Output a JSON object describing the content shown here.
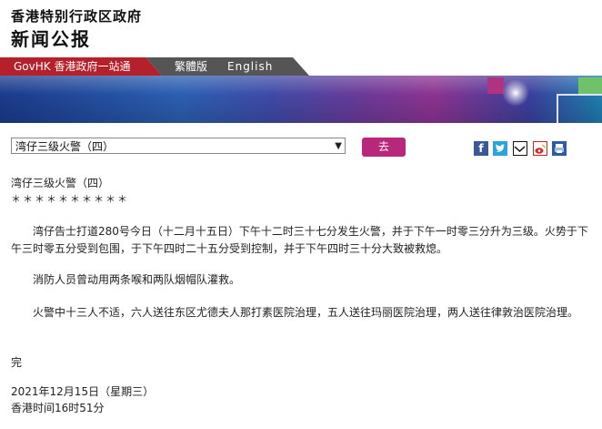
{
  "header": {
    "org_name": "香港特别行政区政府",
    "site_name": "新闻公报"
  },
  "nav": {
    "govhk": "GovHK 香港政府一站通",
    "traditional": "繁體版",
    "english": "English"
  },
  "selector": {
    "selected": "湾仔三级火警（四）",
    "go_label": "去"
  },
  "share_icons": [
    "facebook-icon",
    "twitter-icon",
    "email-icon",
    "weibo-icon",
    "print-icon"
  ],
  "article": {
    "title": "湾仔三级火警（四）",
    "stars": "＊＊＊＊＊＊＊＊＊＊",
    "paragraphs": [
      "湾仔告士打道280号今日（十二月十五日）下午十二时三十七分发生火警，并于下午一时零三分升为三级。火势于下午三时零五分受到包围，于下午四时二十五分受到控制，并于下午四时三十分大致被救熄。",
      "消防人员曾动用两条喉和两队烟帽队灌救。",
      "火警中十三人不适，六人送往东区尤德夫人那打素医院治理，五人送往玛丽医院治理，两人送往律敦治医院治理。"
    ],
    "end": "完",
    "date": "2021年12月15日（星期三）",
    "time": "香港时间16时51分"
  },
  "colors": {
    "nav_red": "#b5202b",
    "nav_gray": "#555555",
    "go_button": "#b8287a"
  }
}
